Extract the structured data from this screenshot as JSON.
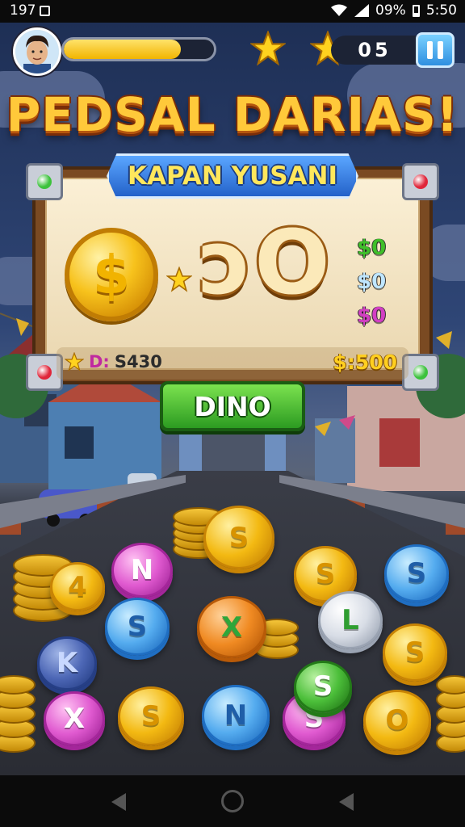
{
  "status_bar": {
    "left_text": "197",
    "battery_percent": "09%",
    "time": "5:50"
  },
  "hud": {
    "xp_progress_fraction": 0.78,
    "score": "05",
    "pause_icon": "pause-icon",
    "star_icon": "star-icon",
    "avatar_icon": "player-avatar"
  },
  "title": "PEDSAL DARIAS!",
  "board": {
    "ribbon_text": "KAPAN YUSANI",
    "big_coin_symbol": "$",
    "big_number": "ɔO",
    "side_values": [
      {
        "text": "$0",
        "color": "#3fbf2a"
      },
      {
        "text": "$0",
        "color": "#bfe6ff"
      },
      {
        "text": "$0",
        "color": "#d23fc3"
      }
    ],
    "info_left_prefix": "D:",
    "info_left_value": "S430",
    "info_right": "$:500",
    "lights": [
      "#3cc23c",
      "#e0263a",
      "#e0263a",
      "#3cc23c"
    ]
  },
  "action_button": "DINO",
  "coins": {
    "letters": [
      "S",
      "N",
      "S",
      "S",
      "4",
      "S",
      "X",
      "L",
      "S",
      "K",
      "X",
      "S",
      "N",
      "S",
      "O",
      "S"
    ]
  },
  "nav": {
    "back_icon": "back-icon",
    "home_icon": "home-icon",
    "recent_icon": "recents-icon"
  }
}
